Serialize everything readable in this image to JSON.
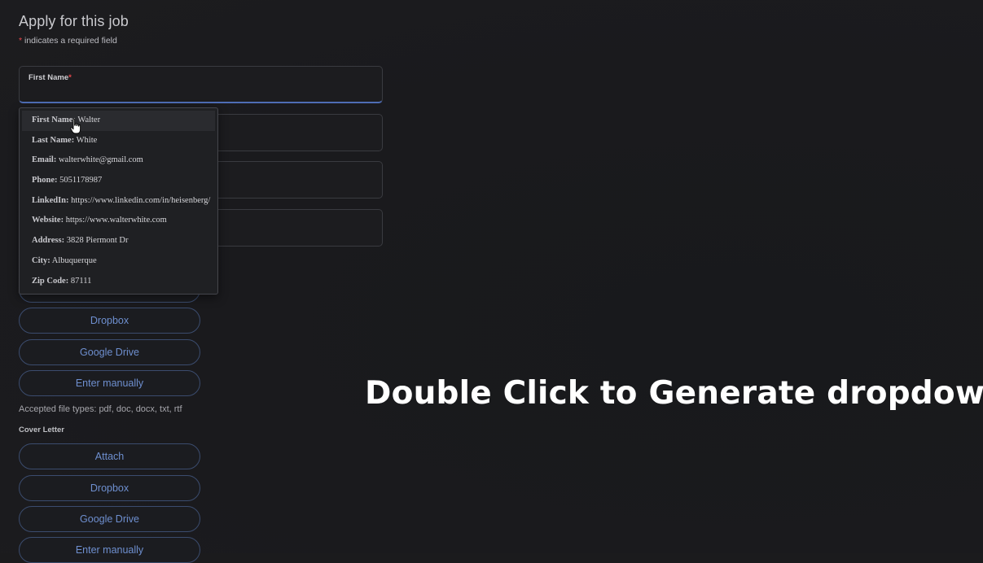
{
  "form": {
    "title": "Apply for this job",
    "required_asterisk": "*",
    "required_note": " indicates a required field",
    "first_name": {
      "label": "First Name",
      "asterisk": "*",
      "value": ""
    },
    "resume_buttons": [
      "Dropbox",
      "Google Drive",
      "Enter manually"
    ],
    "accepted_file_types": "Accepted file types: pdf, doc, docx, txt, rtf",
    "cover_letter": {
      "label": "Cover Letter",
      "buttons": [
        "Attach",
        "Dropbox",
        "Google Drive",
        "Enter manually"
      ]
    }
  },
  "autofill_dropdown": {
    "items": [
      {
        "key": "First Name:",
        "value": " Walter"
      },
      {
        "key": "Last Name:",
        "value": " White"
      },
      {
        "key": "Email:",
        "value": " walterwhite@gmail.com"
      },
      {
        "key": "Phone:",
        "value": " 5051178987"
      },
      {
        "key": "LinkedIn:",
        "value": " https://www.linkedin.com/in/heisenberg/"
      },
      {
        "key": "Website:",
        "value": " https://www.walterwhite.com"
      },
      {
        "key": "Address:",
        "value": " 3828 Piermont Dr"
      },
      {
        "key": "City:",
        "value": " Albuquerque"
      },
      {
        "key": "Zip Code:",
        "value": " 87111"
      }
    ],
    "hovered_index": 0
  },
  "overlay": {
    "caption": "Double Click to Generate dropdown"
  },
  "colors": {
    "background": "#1b1b1d",
    "accent_blue": "#6e8fcf",
    "required_red": "#e8484c",
    "active_underline": "#4e6db5"
  }
}
